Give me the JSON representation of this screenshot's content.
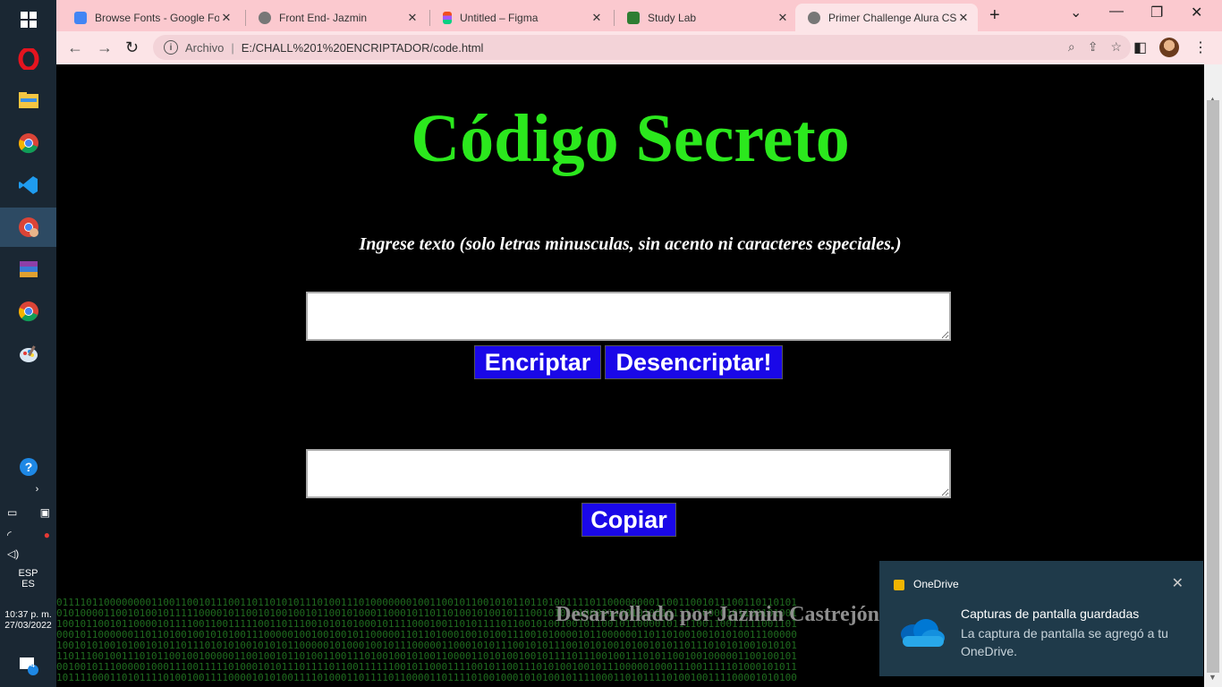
{
  "browser": {
    "tabs": [
      {
        "title": "Browse Fonts - Google Fon",
        "favicon_color": "#4285f4",
        "active": false
      },
      {
        "title": "Front End- Jazmin",
        "favicon_color": "#666666",
        "active": false
      },
      {
        "title": "Untitled – Figma",
        "favicon_color": "#f24e1e",
        "active": false
      },
      {
        "title": "Study Lab",
        "favicon_color": "#2e7d32",
        "active": false
      },
      {
        "title": "Primer Challenge Alura CS",
        "favicon_color": "#666666",
        "active": true
      }
    ],
    "new_tab_label": "+",
    "address": {
      "scheme_label": "Archivo",
      "url": "E:/CHALL%201%20ENCRIPTADOR/code.html"
    }
  },
  "taskbar": {
    "language": "ESP",
    "region": "ES",
    "time": "10:37 p. m.",
    "date": "27/03/2022",
    "notification_count": "4"
  },
  "page": {
    "title": "Código Secreto",
    "instruction": "Ingrese texto (solo letras minusculas, sin acento ni caracteres especiales.)",
    "input_value": "",
    "output_value": "",
    "encrypt_label": "Encriptar",
    "decrypt_label": "Desencriptar!",
    "copy_label": "Copiar",
    "footer_credit": "Desarrollado por Jazmin Castrejón",
    "footer_binary": [
      "0111101100000000110011001011100110110101011101001110100000001001100101100101011011010",
      "0101000011001010010111110000101100101001001011001010001100010110110100101001011100101",
      "1001011001011000010111100110011111001101110010101010001011110001001101011110110010100",
      "0001011000000110110100100101010011100000100100100101100000110110100010010100111001010",
      "1001010100101001010110111010101001010101100000101000100101110000011000101011100101011",
      "1101110010011101011001001000001100100101101001100111010010010100110000110101001001011",
      "0010010111000001000111001111101000101011101111011001111110010110001111001011001110101",
      "1011110001101011110100100111100001010100111101000110111101100001101111010010001010100"
    ]
  },
  "toast": {
    "app": "OneDrive",
    "title": "Capturas de pantalla guardadas",
    "body": "La captura de pantalla se agregó a tu OneDrive.",
    "close_glyph": "✕"
  },
  "colors": {
    "title": "#2be81d",
    "button_bg": "#1a08e8",
    "tab_strip": "#fbc9cf"
  }
}
